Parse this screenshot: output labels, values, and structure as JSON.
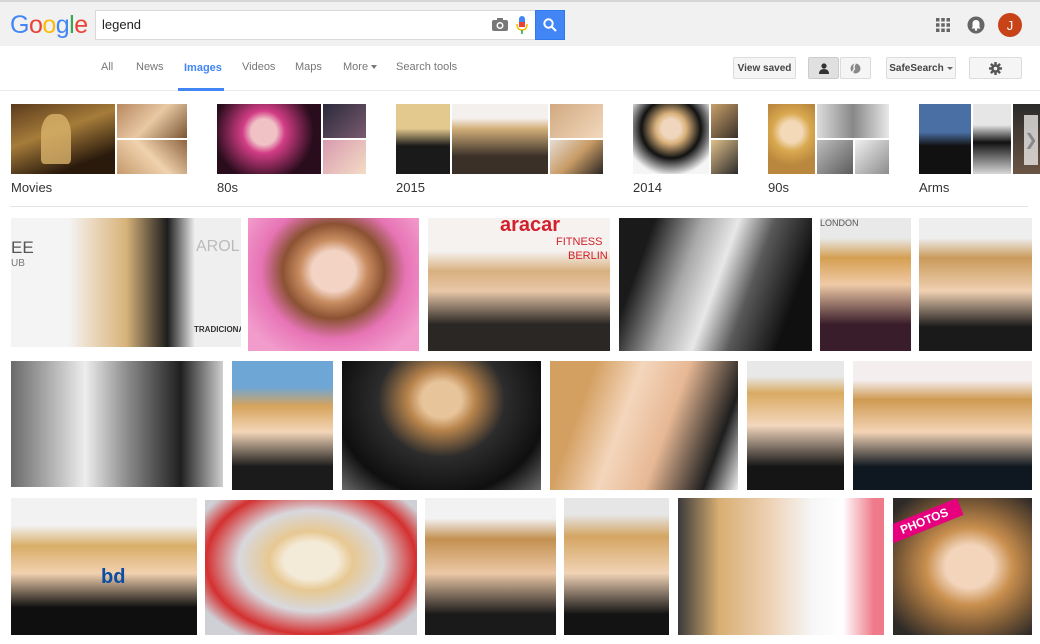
{
  "logo": {
    "letters": [
      "G",
      "o",
      "o",
      "g",
      "l",
      "e"
    ],
    "colors": [
      "#4285f4",
      "#ea4335",
      "#fbbc05",
      "#4285f4",
      "#34a853",
      "#ea4335"
    ]
  },
  "search": {
    "query": "legend"
  },
  "icons": {
    "camera": "camera-icon",
    "mic": "microphone-icon",
    "search": "search-icon",
    "apps": "apps-grid-icon",
    "notifications": "bell-icon",
    "settings": "gear-icon"
  },
  "account": {
    "initial": "J",
    "color": "#c84318"
  },
  "nav": {
    "tabs": [
      "All",
      "News",
      "Images",
      "Videos",
      "Maps",
      "More",
      "Search tools"
    ],
    "active": "Images",
    "view_saved": "View saved",
    "safesearch": "SafeSearch"
  },
  "related": [
    {
      "label": "Movies"
    },
    {
      "label": "80s"
    },
    {
      "label": "2015"
    },
    {
      "label": "2014"
    },
    {
      "label": "90s"
    },
    {
      "label": "Arms"
    }
  ],
  "watermarks": {
    "r1_1a": "EE",
    "r1_1b": "UB",
    "r1_1c": "AROL",
    "r1_1d": "TRADICIONAL",
    "r1_3a": "aracar",
    "r1_3b": "FITNESS",
    "r1_3c": "BERLIN",
    "r1_5": "LONDON",
    "r3_1": "bd",
    "r3_6": "PHOTOS"
  },
  "colors": {
    "accent": "#4285f4",
    "topbar": "#f1f1f1"
  }
}
